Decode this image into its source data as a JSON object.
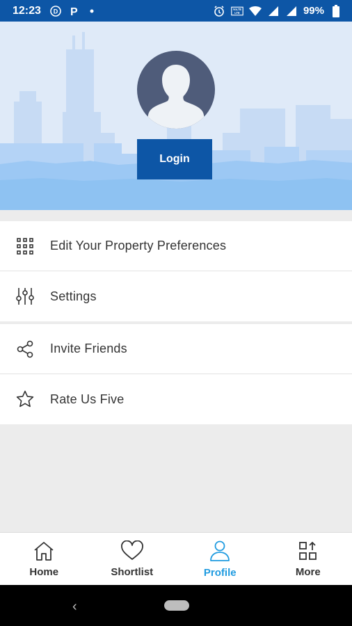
{
  "status_bar": {
    "time": "12:23",
    "battery": "99%",
    "icons": [
      "d-icon",
      "p-icon",
      "dot-icon",
      "alarm-icon",
      "volte-icon",
      "wifi-icon",
      "signal-icon",
      "signal-icon",
      "battery-icon"
    ]
  },
  "hero": {
    "login_label": "Login"
  },
  "menu": {
    "group1": [
      {
        "label": "Edit Your Property Preferences",
        "icon": "grid-dots-icon"
      },
      {
        "label": "Settings",
        "icon": "sliders-icon"
      }
    ],
    "group2": [
      {
        "label": "Invite Friends",
        "icon": "share-icon"
      },
      {
        "label": "Rate Us Five",
        "icon": "star-icon"
      }
    ]
  },
  "bottom_nav": [
    {
      "label": "Home",
      "icon": "home-icon",
      "active": false
    },
    {
      "label": "Shortlist",
      "icon": "heart-icon",
      "active": false
    },
    {
      "label": "Profile",
      "icon": "profile-icon",
      "active": true
    },
    {
      "label": "More",
      "icon": "more-icon",
      "active": false
    }
  ],
  "colors": {
    "brand_blue": "#0d56a6",
    "active_blue": "#1f9be0",
    "hero_bg": "#dfeaf8"
  }
}
